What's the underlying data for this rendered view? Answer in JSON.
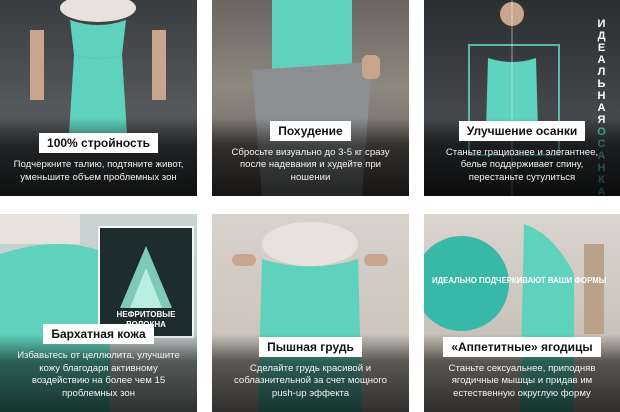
{
  "tiles": [
    {
      "title": "100% стройность",
      "desc": "Подчеркните талию, подтяните живот, уменьшите объем проблемных зон"
    },
    {
      "title": "Похудение",
      "desc": "Сбросьте визуально до 3-5 кг сразу после надевания и худейте при ношении"
    },
    {
      "title": "Улучшение осанки",
      "desc": "Станьте грациознее и элегантнее, белье поддерживает спину, перестаньте сутулиться",
      "vertical_text": [
        "И",
        "Д",
        "Е",
        "А",
        "Л",
        "Ь",
        "Н",
        "А",
        "Я"
      ],
      "vertical_text_accent": [
        "О",
        "С",
        "А",
        "Н",
        "К",
        "А"
      ]
    },
    {
      "title": "Бархатная кожа",
      "desc": "Избавьтесь от целлюлита, улучшите кожу благодаря активному воздействию на более чем 15 проблемных зон",
      "inset_label": "НЕФРИТОВЫЕ ВОЛОКНА"
    },
    {
      "title": "Пышная грудь",
      "desc": "Сделайте грудь красивой и соблазнительной за счет мощного push-up эффекта"
    },
    {
      "title": "«Аппетитные» ягодицы",
      "desc": "Станьте сексуальнее, приподняв ягодичные мышцы и придав им естественную округлую форму",
      "circle_label": "ИДЕАЛЬНО ПОДЧЕРКИВАЮТ ВАШИ ФОРМЫ"
    }
  ],
  "colors": {
    "garment": "#5fd2bd",
    "accent": "#61d9c4",
    "circle": "#2fb7a6"
  }
}
